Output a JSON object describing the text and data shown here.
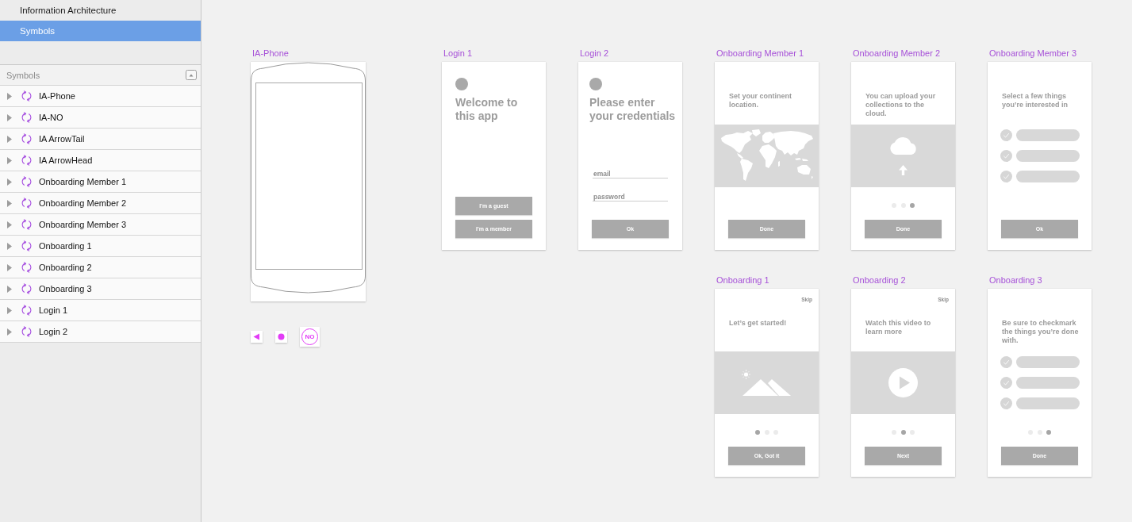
{
  "sidebar": {
    "pages": [
      {
        "label": "Information Architecture",
        "selected": false
      },
      {
        "label": "Symbols",
        "selected": true
      }
    ],
    "layers_header": "Symbols",
    "layers": [
      {
        "name": "IA-Phone",
        "expanded": false
      },
      {
        "name": "IA-NO",
        "expanded": false
      },
      {
        "name": "IA ArrowTail",
        "expanded": false
      },
      {
        "name": "IA ArrowHead",
        "expanded": false
      },
      {
        "name": "Onboarding Member 1",
        "expanded": false
      },
      {
        "name": "Onboarding Member 2",
        "expanded": false
      },
      {
        "name": "Onboarding Member 3",
        "expanded": false
      },
      {
        "name": "Onboarding 1",
        "expanded": false
      },
      {
        "name": "Onboarding 2",
        "expanded": false
      },
      {
        "name": "Onboarding 3",
        "expanded": false
      },
      {
        "name": "Login 1",
        "expanded": false
      },
      {
        "name": "Login 2",
        "expanded": false
      }
    ]
  },
  "canvas": {
    "phone_artboard": {
      "title": "IA-Phone"
    },
    "symbol_tiles": [
      {
        "kind": "triangle"
      },
      {
        "kind": "dot"
      },
      {
        "kind": "badge",
        "text": "NO"
      }
    ],
    "rows": [
      {
        "artboards": [
          {
            "title": "Login 1",
            "kind": "welcome",
            "heading": "Welcome to this app",
            "buttons": [
              "I'm a guest",
              "I'm a member"
            ]
          },
          {
            "title": "Login 2",
            "kind": "credentials",
            "heading": "Please enter your credentials",
            "fields": [
              {
                "placeholder": "email"
              },
              {
                "placeholder": "password"
              }
            ],
            "buttons": [
              "Ok"
            ]
          },
          {
            "title": "Onboarding Member 1",
            "kind": "onboarding",
            "text": "Set your continent location.",
            "media": {
              "kind": "map"
            },
            "buttons": [
              "Done"
            ]
          },
          {
            "title": "Onboarding Member 2",
            "kind": "onboarding",
            "text": "You can upload your collections to the cloud.",
            "media": {
              "kind": "upload"
            },
            "page_dots": [
              {
                "selected": false
              },
              {
                "selected": false
              },
              {
                "selected": true
              }
            ],
            "buttons": [
              "Done"
            ]
          },
          {
            "title": "Onboarding Member 3",
            "kind": "onboarding",
            "text": "Select a few things you’re interested in",
            "media": {
              "kind": "checklist"
            },
            "checklist": [
              {
                "checked": true
              },
              {
                "checked": true
              },
              {
                "checked": true
              }
            ],
            "buttons": [
              "Ok"
            ]
          }
        ]
      },
      {
        "artboards": [
          {
            "title": "Onboarding 1",
            "kind": "onboarding",
            "skip": "Skip",
            "text": "Let’s get started!",
            "media": {
              "kind": "landscape"
            },
            "page_dots": [
              {
                "selected": true
              },
              {
                "selected": false
              },
              {
                "selected": false
              }
            ],
            "buttons": [
              "Ok, Got it"
            ]
          },
          {
            "title": "Onboarding 2",
            "kind": "onboarding",
            "skip": "Skip",
            "text": "Watch this video to learn more",
            "media": {
              "kind": "video"
            },
            "page_dots": [
              {
                "selected": false
              },
              {
                "selected": true
              },
              {
                "selected": false
              }
            ],
            "buttons": [
              "Next"
            ]
          },
          {
            "title": "Onboarding 3",
            "kind": "onboarding",
            "text": "Be sure to checkmark the things you’re done with.",
            "media": {
              "kind": "checklist"
            },
            "checklist": [
              {
                "checked": true
              },
              {
                "checked": true
              },
              {
                "checked": true
              }
            ],
            "page_dots": [
              {
                "selected": false
              },
              {
                "selected": false
              },
              {
                "selected": true
              }
            ],
            "buttons": [
              "Done"
            ]
          }
        ]
      }
    ]
  }
}
